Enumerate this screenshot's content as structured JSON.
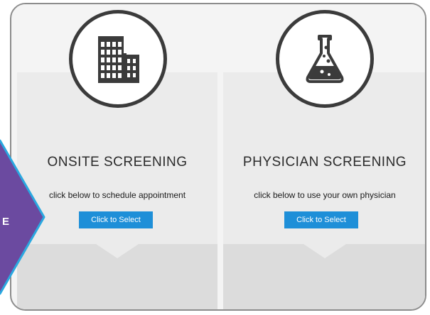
{
  "cards": [
    {
      "title": "ONSITE SCREENING",
      "subtitle": "click below to schedule appointment",
      "button_label": "Click to Select",
      "icon": "building-icon"
    },
    {
      "title": "PHYSICIAN SCREENING",
      "subtitle": "click below to use your own physician",
      "button_label": "Click to Select",
      "icon": "flask-icon"
    }
  ],
  "side_tab": {
    "label": "E"
  },
  "colors": {
    "button": "#1e8fd8",
    "tab_fill": "#6b4aa0",
    "tab_border": "#2aa8e0",
    "icon_stroke": "#3b3b3b"
  }
}
